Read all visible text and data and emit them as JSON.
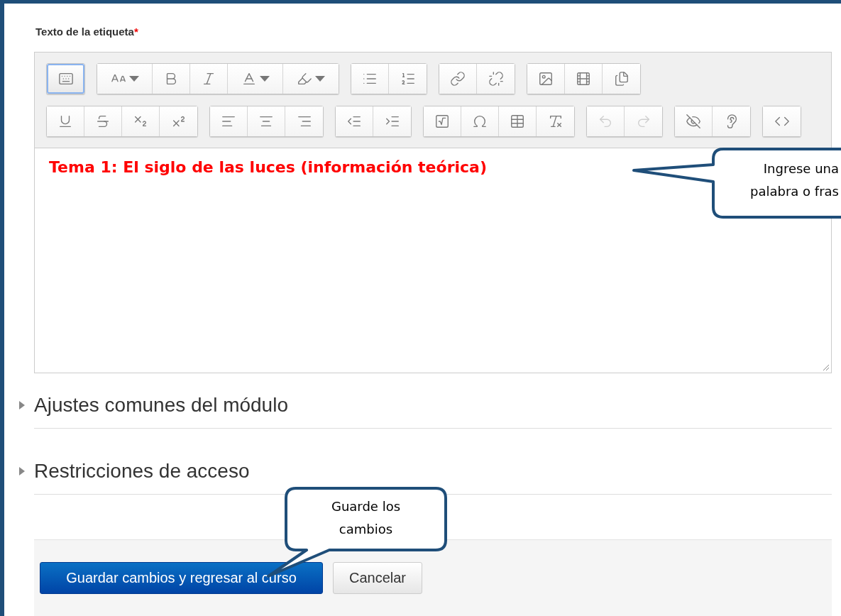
{
  "field": {
    "label": "Texto de la etiqueta",
    "required_mark": "*"
  },
  "toolbar": {
    "rows": [
      {
        "groups": [
          {
            "buttons": [
              {
                "kind": "toggle",
                "active": true,
                "disabled": false
              }
            ]
          },
          {
            "buttons": [
              {
                "kind": "fontsize",
                "active": false,
                "disabled": false
              },
              {
                "kind": "bold",
                "active": false,
                "disabled": false
              },
              {
                "kind": "italic",
                "active": false,
                "disabled": false
              },
              {
                "kind": "color",
                "active": false,
                "disabled": false
              },
              {
                "kind": "highlight",
                "active": false,
                "disabled": false
              }
            ]
          },
          {
            "buttons": [
              {
                "kind": "bullets",
                "active": false,
                "disabled": false
              },
              {
                "kind": "numbers",
                "active": false,
                "disabled": false
              }
            ]
          },
          {
            "buttons": [
              {
                "kind": "link",
                "active": false,
                "disabled": false
              },
              {
                "kind": "unlink",
                "active": false,
                "disabled": false
              }
            ]
          },
          {
            "buttons": [
              {
                "kind": "image",
                "active": false,
                "disabled": false
              },
              {
                "kind": "media",
                "active": false,
                "disabled": false
              },
              {
                "kind": "file",
                "active": false,
                "disabled": false
              }
            ]
          }
        ]
      },
      {
        "groups": [
          {
            "buttons": [
              {
                "kind": "underline",
                "active": false,
                "disabled": false
              },
              {
                "kind": "strike",
                "active": false,
                "disabled": false
              },
              {
                "kind": "subscript",
                "active": false,
                "disabled": false
              },
              {
                "kind": "superscript",
                "active": false,
                "disabled": false
              }
            ]
          },
          {
            "buttons": [
              {
                "kind": "alignleft",
                "active": false,
                "disabled": false
              },
              {
                "kind": "aligncenter",
                "active": false,
                "disabled": false
              },
              {
                "kind": "alignright",
                "active": false,
                "disabled": false
              }
            ]
          },
          {
            "buttons": [
              {
                "kind": "outdent",
                "active": false,
                "disabled": false
              },
              {
                "kind": "indent",
                "active": false,
                "disabled": false
              }
            ]
          },
          {
            "buttons": [
              {
                "kind": "equation",
                "active": false,
                "disabled": false
              },
              {
                "kind": "symbol",
                "active": false,
                "disabled": false
              },
              {
                "kind": "table",
                "active": false,
                "disabled": false
              },
              {
                "kind": "clear",
                "active": false,
                "disabled": false
              }
            ]
          },
          {
            "buttons": [
              {
                "kind": "undo",
                "active": false,
                "disabled": true
              },
              {
                "kind": "redo",
                "active": false,
                "disabled": true
              }
            ]
          },
          {
            "buttons": [
              {
                "kind": "accessibility",
                "active": false,
                "disabled": false
              },
              {
                "kind": "screenreader",
                "active": false,
                "disabled": false
              }
            ]
          },
          {
            "buttons": [
              {
                "kind": "html",
                "active": false,
                "disabled": false
              }
            ]
          }
        ]
      }
    ]
  },
  "editor": {
    "content": "Tema 1: El siglo de las luces (información teórica)"
  },
  "sections": [
    {
      "title": "Ajustes comunes del módulo",
      "expanded": false
    },
    {
      "title": "Restricciones de acceso",
      "expanded": false
    }
  ],
  "buttons": [
    {
      "label": "Guardar cambios y regresar al curso",
      "kind": "primary"
    },
    {
      "label": "Cancelar",
      "kind": "secondary"
    }
  ],
  "callouts": [
    {
      "lines": [
        "Ingrese una",
        "palabra o fras"
      ]
    },
    {
      "lines": [
        "Guarde los",
        "cambios"
      ]
    }
  ]
}
